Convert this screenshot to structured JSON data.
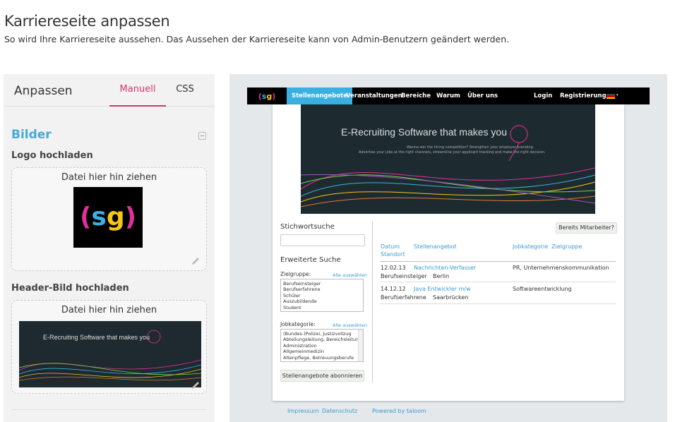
{
  "page": {
    "title": "Karriereseite anpassen",
    "subtitle": "So wird Ihre Karriereseite aussehen. Das Aussehen der Karriereseite kann von Admin-Benutzern geändert werden."
  },
  "panel": {
    "title": "Anpassen",
    "tabs": [
      "Manuell",
      "CSS"
    ],
    "section_title": "Bilder",
    "logo_label": "Logo hochladen",
    "header_label": "Header-Bild hochladen",
    "drop_text": "Datei hier hin ziehen",
    "logo_text": "(sg)",
    "header_img_text": "E-Recruiting Software that makes you"
  },
  "preview": {
    "nav": {
      "logo_text": "(sg)",
      "items": [
        "Stellenangebote",
        "Veranstaltungen",
        "Bereiche",
        "Warum",
        "Über uns"
      ],
      "right_items": [
        "Login",
        "Registrierung"
      ]
    },
    "banner": {
      "title": "E-Recruiting Software that makes you",
      "line1": "Wanna win the hiring competition? Strengthen your employer branding.",
      "line2": "Advertise your jobs at the right channels, streamline your applicant tracking and make the right decision."
    },
    "search": {
      "keyword_label": "Stichwortsuche",
      "advanced_label": "Erweiterte Suche",
      "target_label": "Zielgruppe:",
      "select_all": "Alle auswählen",
      "targets": [
        "Berufseinsteiger",
        "Berufserfahrene",
        "Schüler",
        "Auszubildende",
        "Student"
      ],
      "category_label": "Jobkategorie:",
      "categories": [
        "(Bundes-)Polizei, Justizvollzug",
        "Abteilungsleitung, Bereichsleitung",
        "Administration",
        "Allgemeinmedizin",
        "Altenpflege, Betreuungsberufe"
      ],
      "subscribe_button": "Stellenangebote abonnieren"
    },
    "employee_button": "Bereits Mitarbeiter?",
    "table": {
      "headers": [
        "Datum",
        "Standort",
        "Stellenangebot",
        "Jobkategorie",
        "Zielgruppe"
      ],
      "rows": [
        {
          "date": "12.02.13",
          "title": "Nachrichten-Verfasser",
          "category": "PR, Unternehmenskommunikation",
          "target": "Berufseinsteiger",
          "location": "Berlin"
        },
        {
          "date": "14.12.12",
          "title": "Java Entwickler m/w",
          "category": "Softwareentwicklung",
          "target": "Berufserfahrene",
          "location": "Saarbrücken"
        }
      ]
    },
    "footer": [
      "Impressum",
      "Datenschutz",
      "Powered by taloom"
    ]
  },
  "colors": {
    "accent_pink": "#d6336c",
    "accent_blue": "#4aa8d8",
    "nav_active": "#3ab0e2"
  }
}
